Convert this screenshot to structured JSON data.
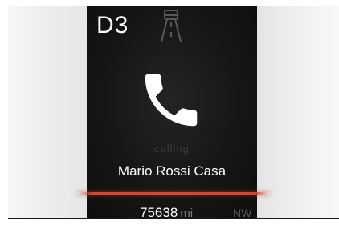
{
  "instrument_display": {
    "gear": "D3",
    "call": {
      "status": "calling",
      "contact_name": "Mario Rossi Casa"
    },
    "odometer": {
      "value": "75638",
      "unit": "mi"
    },
    "compass_heading": "NW"
  },
  "colors": {
    "screen_background": "#141414",
    "text_primary": "#ffffff",
    "accent_bar": "#d64632"
  },
  "icons": [
    "phone-handset-icon",
    "car-top-icon"
  ]
}
